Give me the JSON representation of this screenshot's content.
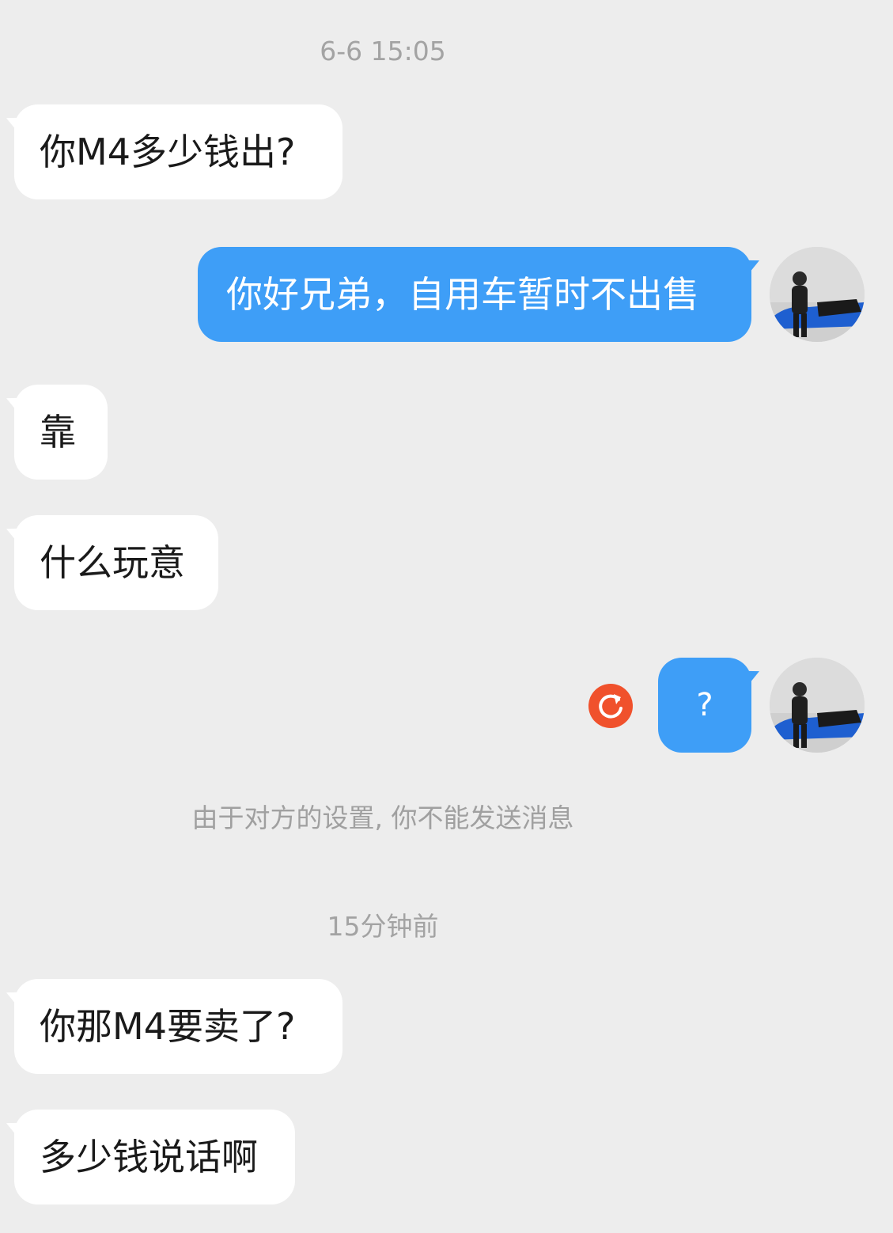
{
  "messages": {
    "timestamp_1": "6-6 15:05",
    "msg_1": "你M4多少钱出?",
    "msg_2": "你好兄弟，自用车暂时不出售",
    "msg_3": "靠",
    "msg_4": "什么玩意",
    "msg_5": "?",
    "notice": "由于对方的设置, 你不能发送消息",
    "timestamp_2": "15分钟前",
    "msg_6": "你那M4要卖了?",
    "msg_7": "多少钱说话啊"
  },
  "colors": {
    "background": "#ededed",
    "incoming_bubble": "#ffffff",
    "outgoing_bubble": "#3e9ef7",
    "resend_icon": "#f0512c"
  },
  "icons": {
    "resend": "resend-icon",
    "avatar": "avatar"
  }
}
